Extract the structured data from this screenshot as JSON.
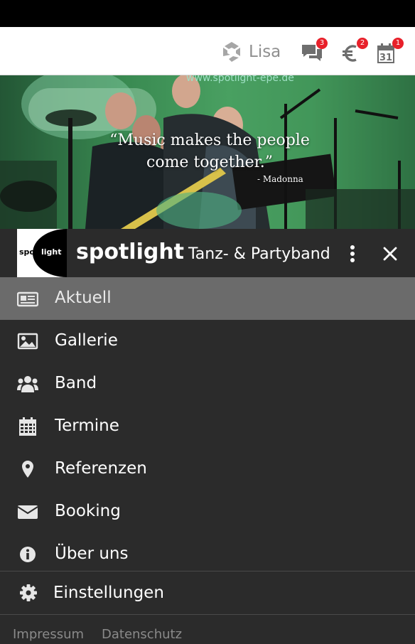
{
  "header": {
    "user_name": "Lisa",
    "badges": {
      "messages": "3",
      "payments": "2",
      "calendar": "1"
    },
    "calendar_day": "31"
  },
  "hero": {
    "quote_line1": "“Music makes the people",
    "quote_line2": "come together.”",
    "quote_author": "- Madonna",
    "url_text": "www.spotlight-epe.de"
  },
  "brand": {
    "logo_left": "spot",
    "logo_right": "light",
    "name": "spotlight",
    "subtitle": "Tanz- & Partyband"
  },
  "menu": {
    "items": [
      {
        "label": "Aktuell",
        "icon": "newspaper-icon",
        "active": true
      },
      {
        "label": "Gallerie",
        "icon": "image-icon"
      },
      {
        "label": "Band",
        "icon": "users-icon"
      },
      {
        "label": "Termine",
        "icon": "calendar-icon"
      },
      {
        "label": "Referenzen",
        "icon": "map-pin-icon"
      },
      {
        "label": "Booking",
        "icon": "envelope-icon"
      },
      {
        "label": "Über uns",
        "icon": "info-icon"
      }
    ],
    "settings_label": "Einstellungen"
  },
  "footer": {
    "impressum": "Impressum",
    "datenschutz": "Datenschutz"
  },
  "colors": {
    "drawer_bg": "#2b2b2b",
    "active_item_bg": "#6b6b6b",
    "badge_red": "#e8202a",
    "header_bg": "#ffffff"
  }
}
